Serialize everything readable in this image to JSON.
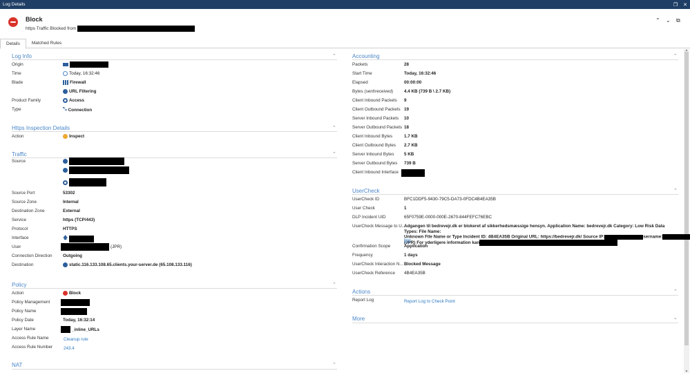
{
  "window": {
    "title": "Log Details",
    "close": "✕",
    "restore": "❐"
  },
  "header": {
    "title": "Block",
    "subtitle_prefix": "https Traffic Blocked from"
  },
  "tabs": [
    {
      "label": "Details"
    },
    {
      "label": "Matched Rules"
    }
  ],
  "log_info": {
    "title": "Log Info",
    "origin_label": "Origin",
    "time_label": "Time",
    "time_value": "Today, 16:32:46",
    "blade_label": "Blade",
    "blade_values": [
      "Firewall",
      "URL Filtering"
    ],
    "product_family_label": "Product Family",
    "product_family_value": "Access",
    "type_label": "Type",
    "type_value": "Connection"
  },
  "https": {
    "title": "Https Inspection Details",
    "action_label": "Action",
    "action_value": "Inspect"
  },
  "traffic": {
    "title": "Traffic",
    "source_label": "Source",
    "source_port_label": "Source Port",
    "source_port_value": "53302",
    "source_zone_label": "Source Zone",
    "source_zone_value": "Internal",
    "dest_zone_label": "Destination Zone",
    "dest_zone_value": "External",
    "service_label": "Service",
    "service_value": "https (TCP/443)",
    "protocol_label": "Protocol",
    "protocol_value": "HTTPS",
    "interface_label": "Interface",
    "user_label": "User",
    "user_suffix": "(JPR)",
    "conn_dir_label": "Connection Direction",
    "conn_dir_value": "Outgoing",
    "destination_label": "Destination",
    "destination_value": "static.116.133.108.65.clients.your-server.de (65.108.133.116)"
  },
  "policy": {
    "title": "Policy",
    "action_label": "Action",
    "action_value": "Block",
    "mgmt_label": "Policy Management",
    "name_label": "Policy Name",
    "date_label": "Policy Date",
    "date_value": "Today, 16:32:14",
    "layer_label": "Layer Name",
    "layer_suffix": "_inline_URLs",
    "rule_name_label": "Access Rule Name",
    "rule_name_value": "Cleanup rule",
    "rule_number_label": "Access Rule Number",
    "rule_number_value": "243.4"
  },
  "nat": {
    "title": "NAT"
  },
  "accounting": {
    "title": "Accounting",
    "rows": [
      {
        "label": "Packets",
        "value": "28"
      },
      {
        "label": "Start Time",
        "value": "Today, 16:32:46"
      },
      {
        "label": "Elapsed",
        "value": "00:00:00"
      },
      {
        "label": "Bytes (sent\\received)",
        "value": "4.4 KB (739 B \\ 2.7 KB)"
      },
      {
        "label": "Client Inbound Packets",
        "value": "9"
      },
      {
        "label": "Client Outbound Packets",
        "value": "19"
      },
      {
        "label": "Server Inbound Packets",
        "value": "10"
      },
      {
        "label": "Server Outbound Packets",
        "value": "18"
      },
      {
        "label": "Client Inbound Bytes",
        "value": "1.7 KB"
      },
      {
        "label": "Client Outbound Bytes",
        "value": "2.7 KB"
      },
      {
        "label": "Server Inbound Bytes",
        "value": "5 KB"
      },
      {
        "label": "Server Outbound Bytes",
        "value": "739 B"
      },
      {
        "label": "Client Inbound Interface",
        "value": ""
      }
    ]
  },
  "usercheck": {
    "title": "UserCheck",
    "id_label": "UserCheck ID",
    "id_value": "BFC1DDF5-9430-79C5-DA73-0FDC4B4EA35B",
    "uc_label": "User Check",
    "uc_value": "1",
    "dlp_label": "DLP Incident UID",
    "dlp_value": "65F0759E-0000-000E-2670-844FEFC76EBC",
    "msg_label": "UserCheck Message to U...",
    "msg_line1": "Adgangen til bedrevejr.dk er blokeret af sikkerhedsmæssige hensyn. Application Name: bedrevejr.dk Category: Low Risk Data Types: File Name:",
    "msg_line2": "Unknown File Name or Type Incident ID: 4B4EA35B Original URL: https://bedrevejr.dk/ Source IP:",
    "msg_line2_user": "sername:",
    "msg_line3": "(JPR) For yderligere information kan",
    "msg_less": "less",
    "scope_label": "Confirmation Scope",
    "scope_value": "Application",
    "freq_label": "Frequency",
    "freq_value": "1 days",
    "interaction_label": "UserCheck Interaction N...",
    "interaction_value": "Blocked Message",
    "ref_label": "UserCheck Reference",
    "ref_value": "4B4EA35B"
  },
  "actions": {
    "title": "Actions",
    "report_label": "Report Log",
    "report_link": "Report Log to Check Point"
  },
  "more": {
    "title": "More"
  },
  "colors": {
    "accent": "#4a86c8",
    "block": "#d9322b",
    "titlebar": "#1f3f66",
    "link": "#2c79c4"
  }
}
